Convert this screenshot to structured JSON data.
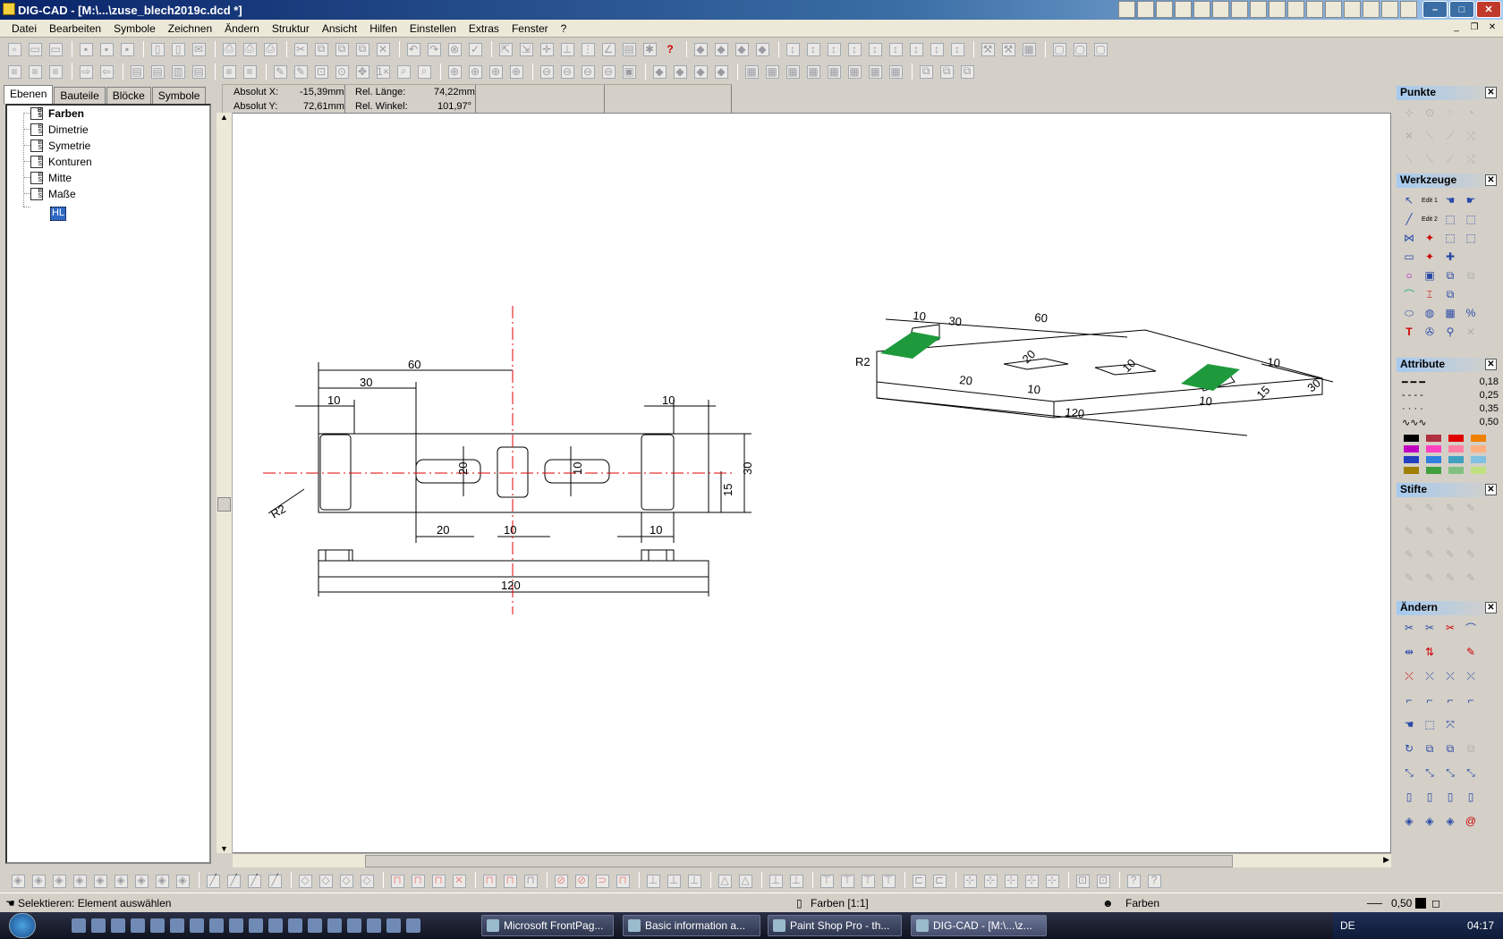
{
  "window": {
    "title": "DIG-CAD - [M:\\...\\zuse_blech2019c.dcd *]"
  },
  "menu": [
    "Datei",
    "Bearbeiten",
    "Symbole",
    "Zeichnen",
    "Ändern",
    "Struktur",
    "Ansicht",
    "Hilfen",
    "Einstellen",
    "Extras",
    "Fenster",
    "?"
  ],
  "left_panel": {
    "tabs": [
      "Ebenen",
      "Bauteile",
      "Blöcke",
      "Symbole"
    ],
    "layers": [
      "Farben",
      "Dimetrie",
      "Symetrie",
      "Konturen",
      "Mitte",
      "Maße"
    ],
    "selected_layer": "HL"
  },
  "coords": {
    "abs_x_label": "Absolut X:",
    "abs_x": "-15,39mm",
    "abs_y_label": "Absolut Y:",
    "abs_y": "72,61mm",
    "rel_len_label": "Rel. Länge:",
    "rel_len": "74,22mm",
    "rel_ang_label": "Rel. Winkel:",
    "rel_ang": "101,97°"
  },
  "drawing": {
    "front_dims": [
      "60",
      "30",
      "10",
      "10",
      "20",
      "20",
      "10",
      "10",
      "10",
      "30",
      "15",
      "R2"
    ],
    "side_dims": [
      "120"
    ],
    "iso_dims": [
      "10",
      "30",
      "60",
      "R2",
      "20",
      "20",
      "10",
      "10",
      "120",
      "10",
      "15",
      "30",
      "10"
    ]
  },
  "right_panel": {
    "punkte": "Punkte",
    "werkzeuge": "Werkzeuge",
    "attribute": "Attribute",
    "line_widths": [
      "0,18",
      "0,25",
      "0,35",
      "0,50"
    ],
    "stifte": "Stifte",
    "aendern": "Ändern",
    "edit1": "Edit 1",
    "edit2": "Edit 2",
    "text_tool": "T"
  },
  "colors": {
    "accent": "#0a246a",
    "centerline": "#e00000",
    "green_fill": "#1e9a3c",
    "swatches": [
      "#000000",
      "#b03040",
      "#e00000",
      "#f08000",
      "#c000c0",
      "#ff40c0",
      "#ff80a0",
      "#ffb080",
      "#2040c0",
      "#3080e0",
      "#40a0c0",
      "#80c0e0",
      "#a08000",
      "#40a040",
      "#80c080",
      "#c0e080"
    ]
  },
  "status": {
    "left": "Selektieren: Element auswählen",
    "layer_scale": "Farben [1:1]",
    "layer": "Farben",
    "linewidth": "0,50"
  },
  "taskbar": {
    "tasks": [
      "Microsoft FrontPag...",
      "Basic information a...",
      "Paint Shop Pro - th...",
      "DIG-CAD - [M:\\...\\z..."
    ],
    "lang": "DE",
    "clock": "04:17"
  }
}
